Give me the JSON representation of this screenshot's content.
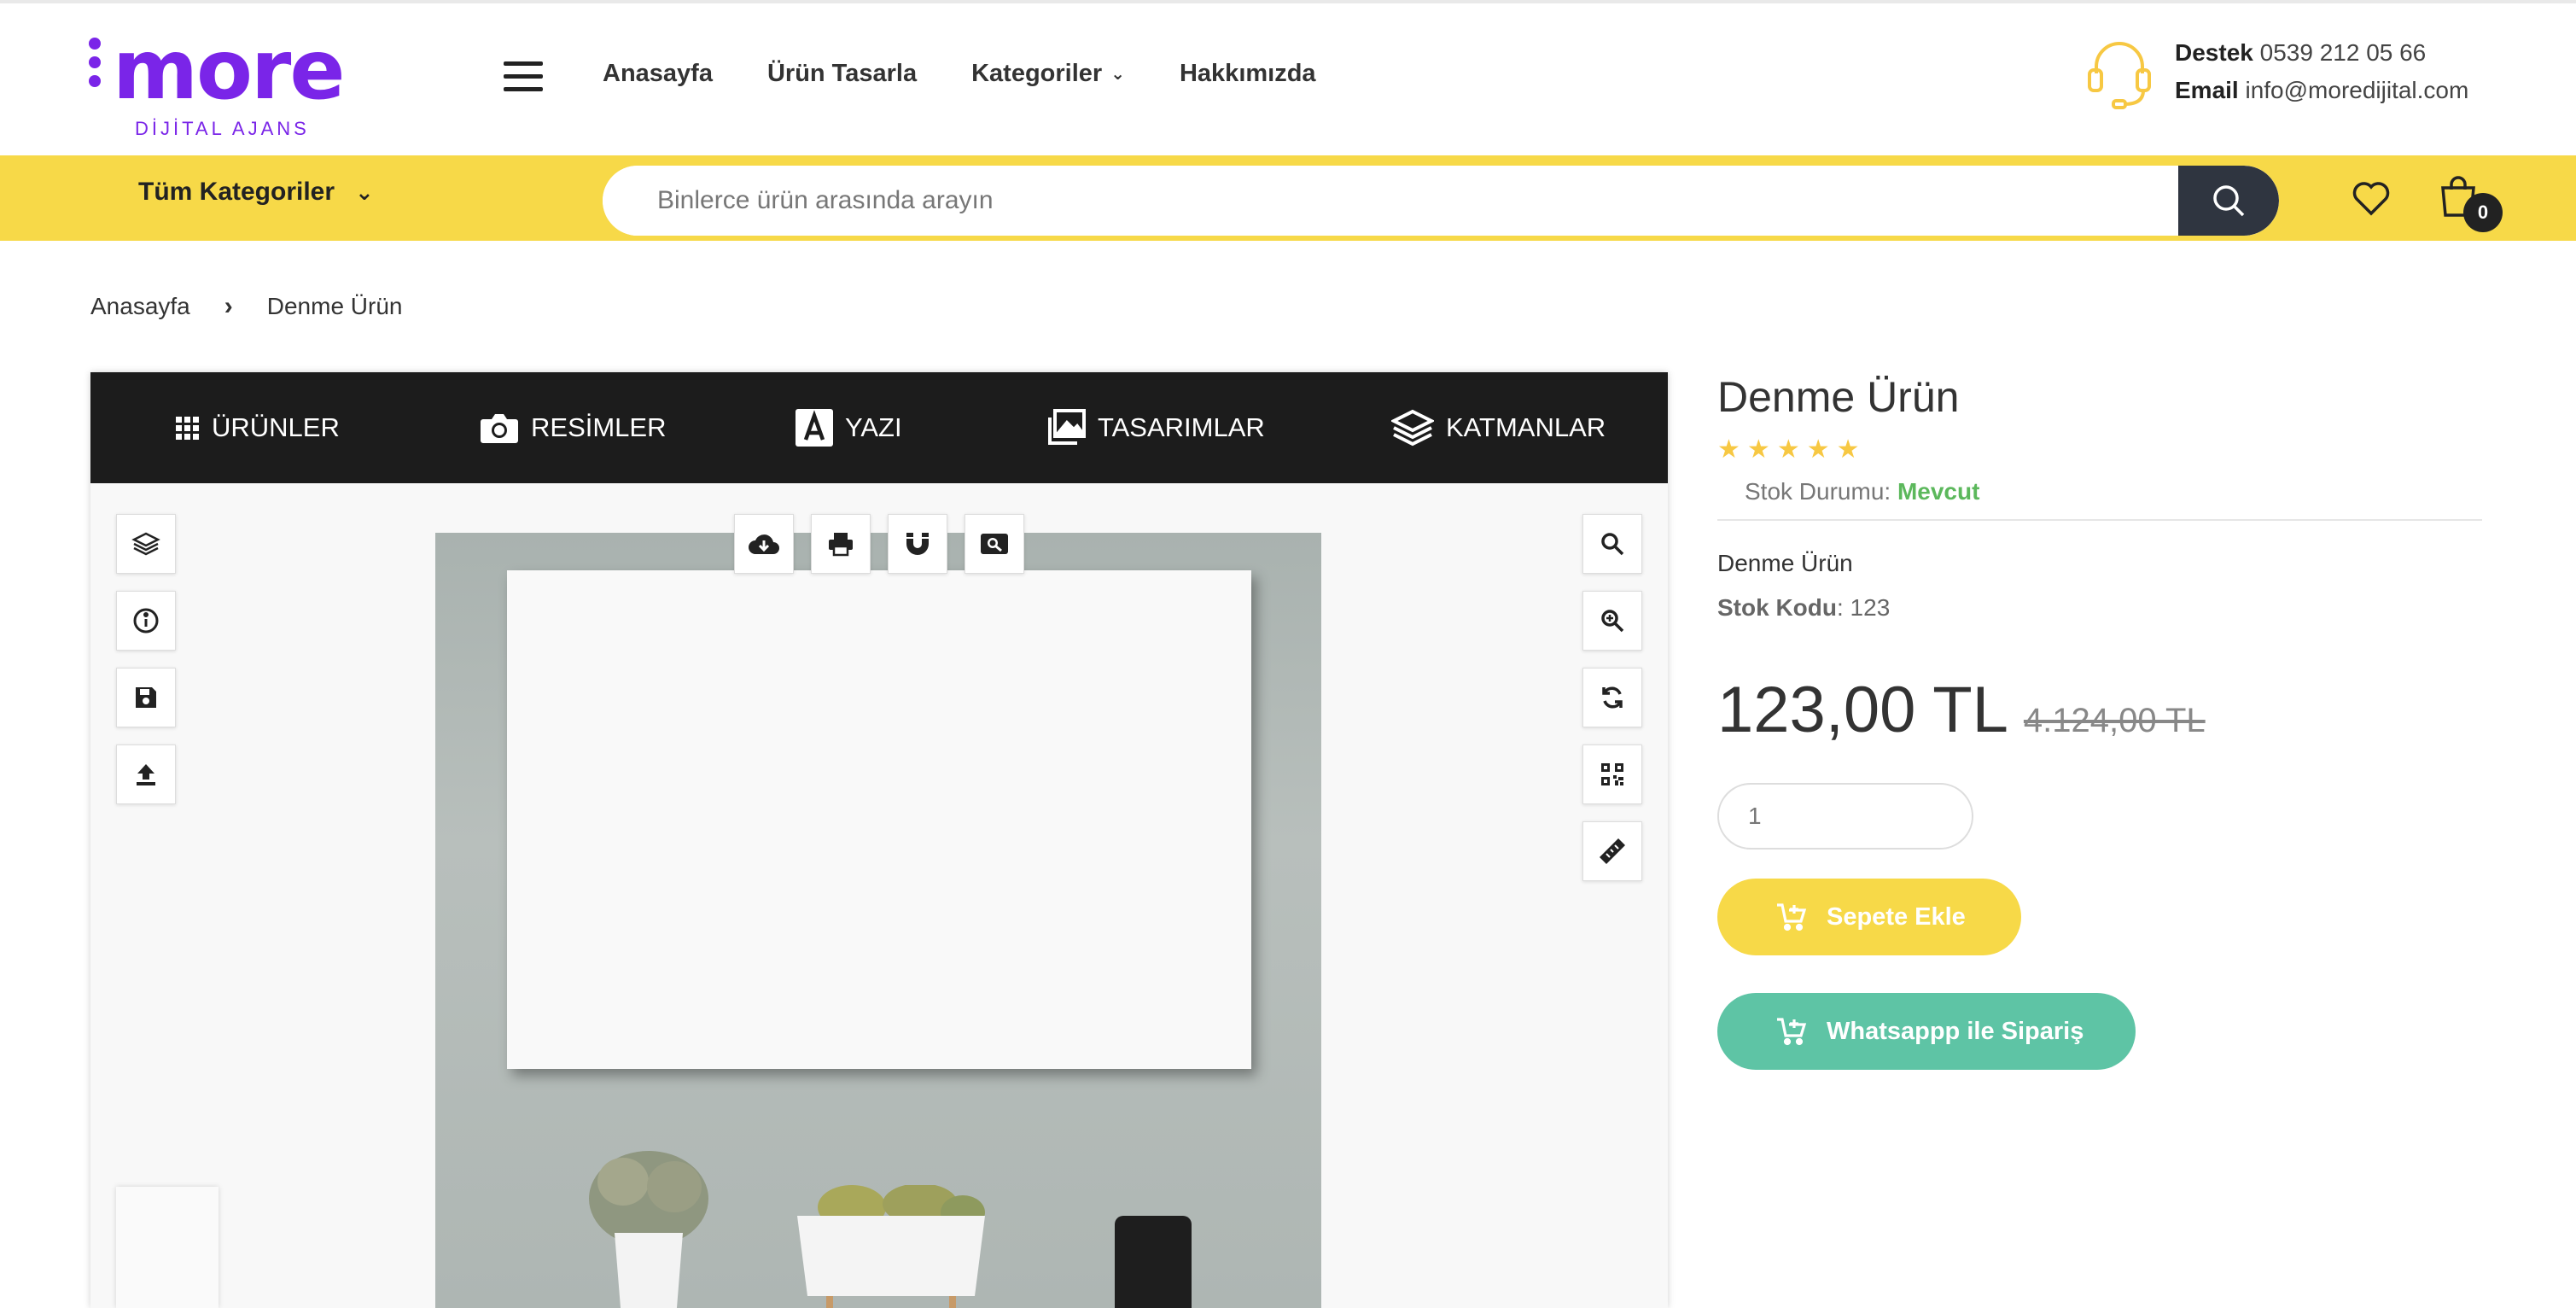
{
  "header": {
    "logo": {
      "word": "more",
      "subtitle": "DİJİTAL AJANS"
    },
    "nav": [
      {
        "label": "Anasayfa"
      },
      {
        "label": "Ürün Tasarla"
      },
      {
        "label": "Kategoriler"
      },
      {
        "label": "Hakkımızda"
      }
    ],
    "contact": {
      "support_label": "Destek",
      "support_value": "0539 212 05 66",
      "email_label": "Email",
      "email_value": "info@moredijital.com"
    }
  },
  "searchbar": {
    "categories_label": "Tüm Kategoriler",
    "placeholder": "Binlerce ürün arasında arayın",
    "cart_count": "0"
  },
  "breadcrumb": [
    "Anasayfa",
    "Denme Ürün"
  ],
  "designer": {
    "tabs": [
      {
        "label": "ÜRÜNLER",
        "icon": "grid-icon"
      },
      {
        "label": "RESİMLER",
        "icon": "camera-icon"
      },
      {
        "label": "YAZI",
        "icon": "text-icon"
      },
      {
        "label": "TASARIMLAR",
        "icon": "images-icon"
      },
      {
        "label": "KATMANLAR",
        "icon": "layers-icon"
      }
    ],
    "left_tools": [
      "layers-icon",
      "info-icon",
      "save-icon",
      "upload-icon"
    ],
    "top_tools": [
      "cloud-download-icon",
      "print-icon",
      "magnet-icon",
      "preview-icon"
    ],
    "right_tools": [
      "zoom-icon",
      "zoom-in-icon",
      "reset-icon",
      "qr-code-icon",
      "ruler-icon"
    ]
  },
  "product": {
    "title": "Denme Ürün",
    "rating": 5,
    "stock_label": "Stok Durumu:",
    "stock_value": "Mevcut",
    "description": "Denme Ürün",
    "code_label": "Stok Kodu",
    "code_value": ": 123",
    "price": "123,00 TL",
    "old_price": "4.124,00 TL",
    "quantity": "1",
    "add_to_cart": "Sepete Ekle",
    "whatsapp_order": "Whatsappp ile Sipariş"
  },
  "colors": {
    "brand_purple": "#7a25e8",
    "bar_yellow": "#f7d948",
    "search_button": "#2f3540",
    "whatsapp_green": "#5ec4a5",
    "stock_green": "#5cb85c"
  }
}
